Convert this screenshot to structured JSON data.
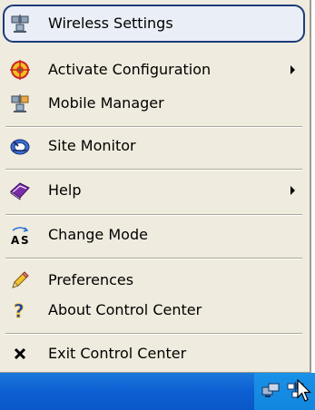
{
  "menu": {
    "items": [
      {
        "label": "Wireless Settings",
        "icon": "wireless-settings-icon",
        "has_submenu": false,
        "highlighted": true
      },
      {
        "label": "Activate Configuration",
        "icon": "activate-configuration-icon",
        "has_submenu": true
      },
      {
        "label": "Mobile Manager",
        "icon": "mobile-manager-icon",
        "has_submenu": false
      },
      {
        "label": "Site Monitor",
        "icon": "site-monitor-icon",
        "has_submenu": false
      },
      {
        "label": "Help",
        "icon": "help-book-icon",
        "has_submenu": true
      },
      {
        "label": "Change Mode",
        "icon": "change-mode-icon",
        "has_submenu": false
      },
      {
        "label": "Preferences",
        "icon": "preferences-pencil-icon",
        "has_submenu": false
      },
      {
        "label": "About Control Center",
        "icon": "question-mark-icon",
        "has_submenu": false
      },
      {
        "label": "Exit Control Center",
        "icon": "exit-x-icon",
        "has_submenu": false
      }
    ]
  },
  "taskbar": {
    "tray_icons": [
      "network-computers-icon",
      "control-center-tray-icon"
    ]
  },
  "colors": {
    "menu_background": "#efebde",
    "highlight_border": "#1c3b7a",
    "taskbar_blue": "#0d5fd2",
    "tray_blue": "#1186de"
  }
}
